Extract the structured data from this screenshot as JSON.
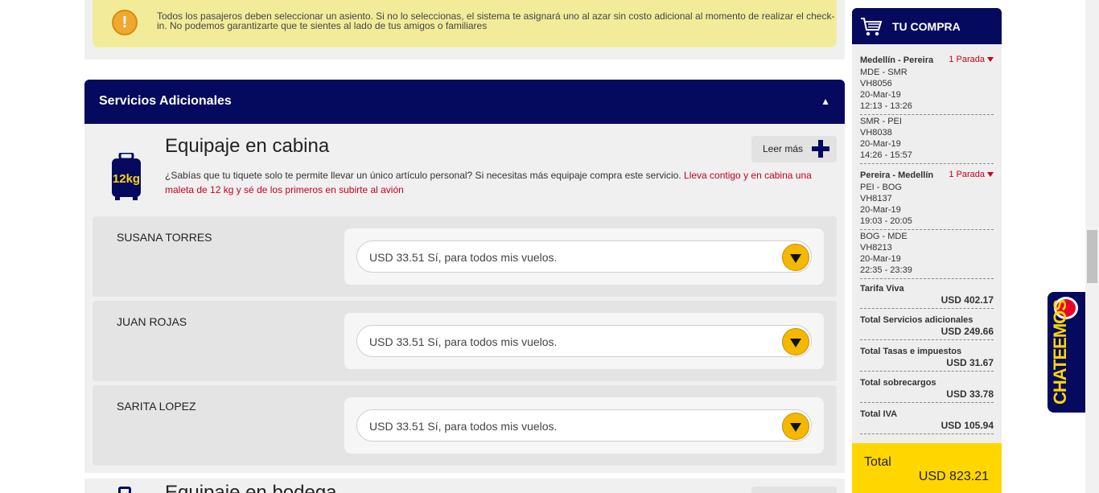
{
  "notice": {
    "icon": "exclamation-icon",
    "text": "Todos los pasajeros deben seleccionar un asiento. Si no lo seleccionas, el sistema te asignará uno al azar sin costo adicional al momento de realizar el check-in. No podemos garantizarte que te sientes al lado de tus amigos o familiares"
  },
  "section": {
    "title": "Servicios Adicionales",
    "toggle": "▲"
  },
  "cabin": {
    "title": "Equipaje en cabina",
    "icon_label": "12kg",
    "leer_label": "Leer más",
    "desc_black": "¿Sabías que tu tiquete solo te permite llevar un único artículo personal? Si necesitas más equipaje compra este servicio. ",
    "desc_red": "Lleva contigo y en cabina una maleta de 12 kg y sé de los primeros en subirte al avión"
  },
  "passengers": [
    {
      "name": "SUSANA TORRES",
      "selection": "USD 33.51 Sí, para todos mis vuelos."
    },
    {
      "name": "JUAN ROJAS",
      "selection": "USD 33.51 Sí, para todos mis vuelos."
    },
    {
      "name": "SARITA LOPEZ",
      "selection": "USD 33.51 Sí, para todos mis vuelos."
    }
  ],
  "hold": {
    "title": "Equipaje en bodega"
  },
  "cart": {
    "title": "TU COMPRA",
    "trips": [
      {
        "route": "Medellín - Pereira",
        "stops": "1 Parada",
        "legs": [
          {
            "code": "MDE - SMR",
            "flight": "VH8056",
            "date": "20-Mar-19",
            "time": "12:13 - 13:26"
          },
          {
            "code": "SMR - PEI",
            "flight": "VH8038",
            "date": "20-Mar-19",
            "time": "14:26 - 15:57"
          }
        ]
      },
      {
        "route": "Pereira - Medellín",
        "stops": "1 Parada",
        "legs": [
          {
            "code": "PEI - BOG",
            "flight": "VH8137",
            "date": "20-Mar-19",
            "time": "19:03 - 20:05"
          },
          {
            "code": "BOG - MDE",
            "flight": "VH8213",
            "date": "20-Mar-19",
            "time": "22:35 - 23:39"
          }
        ]
      }
    ],
    "lines": [
      {
        "label": "Tarifa Viva",
        "amount": "USD 402.17"
      },
      {
        "label": "Total Servicios adicionales",
        "amount": "USD 249.66"
      },
      {
        "label": "Total Tasas e impuestos",
        "amount": "USD 31.67"
      },
      {
        "label": "Total sobrecargos",
        "amount": "USD 33.78"
      },
      {
        "label": "Total IVA",
        "amount": "USD 105.94"
      }
    ],
    "total_label": "Total",
    "total_amount": "USD 823.21"
  },
  "chat": {
    "label": "CHATEEMOS"
  },
  "colors": {
    "navy": "#050a5e",
    "yellow": "#ffd600",
    "red": "#c8001a",
    "notice": "#f2ec9a"
  }
}
